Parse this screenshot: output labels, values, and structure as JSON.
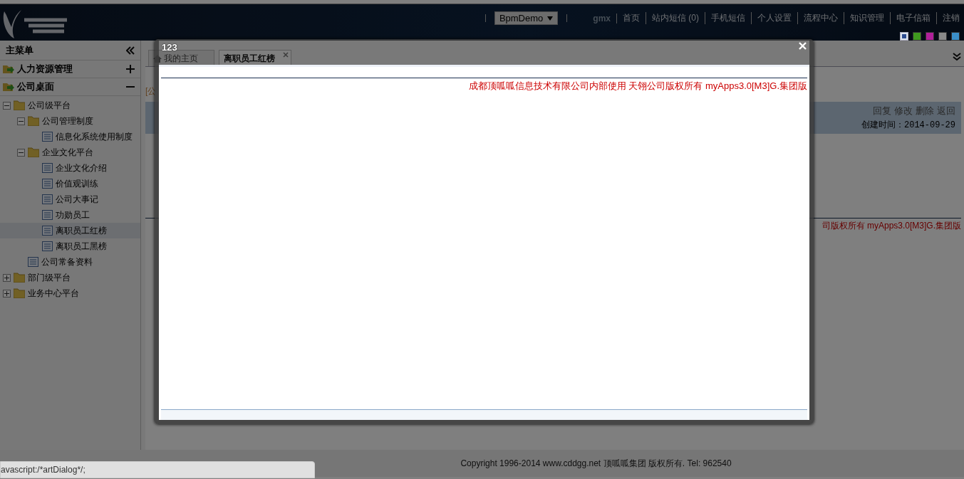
{
  "header": {
    "app_select": "BpmDemo",
    "user": "gmx",
    "links": [
      "首页",
      "站内短信 (0)",
      "手机短信",
      "个人设置",
      "流程中心",
      "知识管理",
      "电子信箱",
      "注销"
    ],
    "themes": [
      {
        "color": "#2c4c90",
        "selected": true
      },
      {
        "color": "#3f9a1f",
        "selected": false
      },
      {
        "color": "#b0209a",
        "selected": false
      },
      {
        "color": "#8a8a8a",
        "selected": false
      },
      {
        "color": "#3b8fc8",
        "selected": false
      }
    ]
  },
  "sidebar": {
    "title": "主菜单",
    "sections": [
      {
        "label": "人力资源管理",
        "expanded": false
      },
      {
        "label": "公司桌面",
        "expanded": true
      }
    ],
    "tree": [
      {
        "label": "公司级平台",
        "kind": "folder",
        "expanded": true,
        "selected": false,
        "children": [
          {
            "label": "公司管理制度",
            "kind": "folder",
            "expanded": true,
            "selected": false,
            "children": [
              {
                "label": "信息化系统使用制度",
                "kind": "doc",
                "selected": false
              }
            ]
          },
          {
            "label": "企业文化平台",
            "kind": "folder",
            "expanded": true,
            "selected": false,
            "children": [
              {
                "label": "企业文化介绍",
                "kind": "doc",
                "selected": false
              },
              {
                "label": "价值观训练",
                "kind": "doc",
                "selected": false
              },
              {
                "label": "公司大事记",
                "kind": "doc",
                "selected": false
              },
              {
                "label": "功勋员工",
                "kind": "doc",
                "selected": false
              },
              {
                "label": "离职员工红榜",
                "kind": "doc",
                "selected": true
              },
              {
                "label": "离职员工黑榜",
                "kind": "doc",
                "selected": false
              }
            ]
          },
          {
            "label": "公司常备资料",
            "kind": "doc",
            "selected": false
          }
        ]
      },
      {
        "label": "部门级平台",
        "kind": "folder",
        "expanded": false,
        "selected": false
      },
      {
        "label": "业务中心平台",
        "kind": "folder",
        "expanded": false,
        "selected": false
      }
    ]
  },
  "tabs": [
    {
      "label": "我的主页",
      "selected": false
    },
    {
      "label": "离职员工红榜",
      "selected": true
    }
  ],
  "content": {
    "breadcrumb": "[公",
    "actions": [
      "回复",
      "修改",
      "删除",
      "返回"
    ],
    "created": "创建时间：2014-09-29",
    "notice": "司版权所有 myApps3.0[M3]G.集团版"
  },
  "dialog": {
    "title": "123",
    "notice": "成都顶呱呱信息技术有限公司内部使用 天翎公司版权所有 myApps3.0[M3]G.集团版"
  },
  "footer": "Copyright 1996-2014 www.cddgg.net 顶呱呱集团 版权所有. Tel: 962540",
  "status_bar": "avascript:/*artDialog*/;"
}
